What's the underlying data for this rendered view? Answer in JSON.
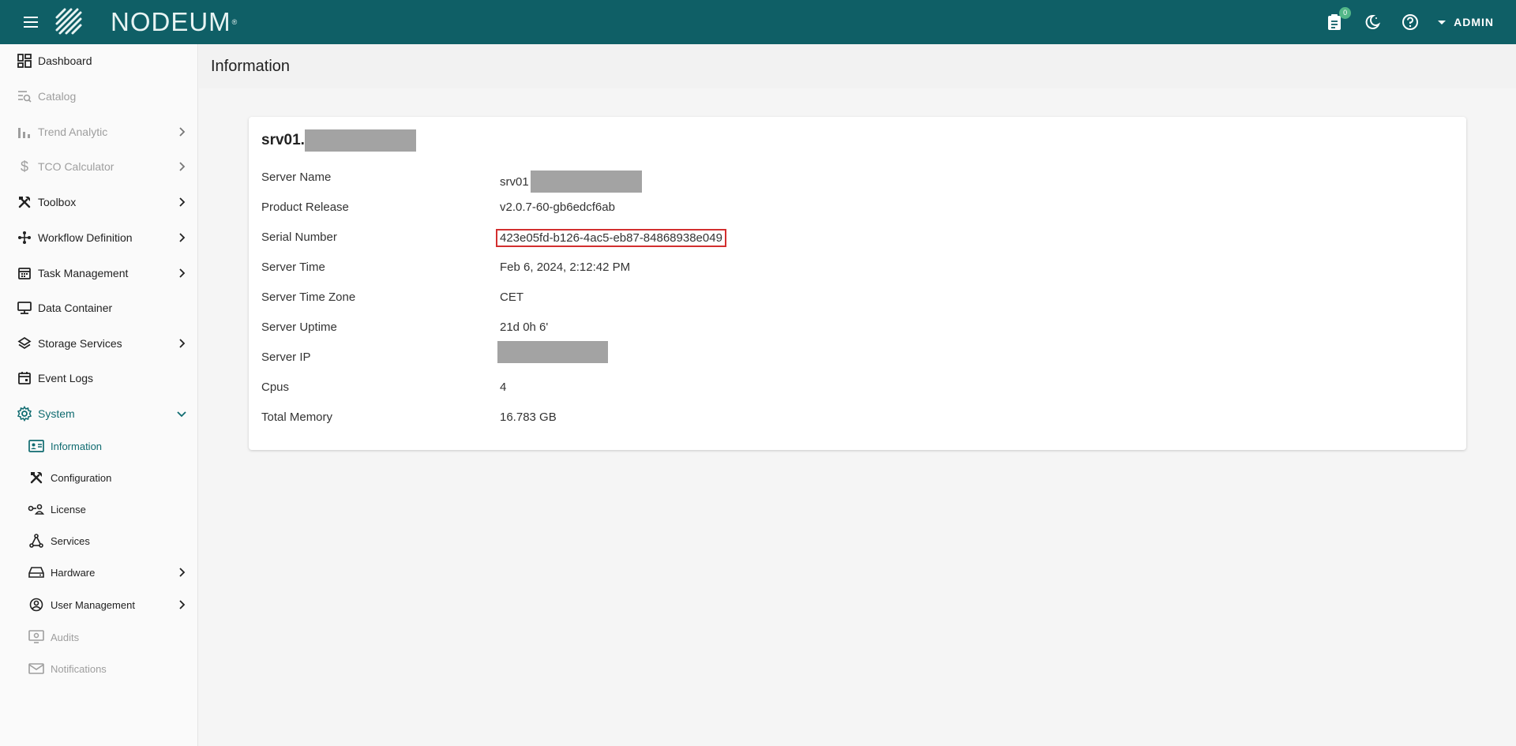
{
  "app": {
    "logo_text": "NODEUM",
    "logo_reg": "®",
    "notification_count": "0",
    "user": "ADMIN"
  },
  "sidebar": {
    "items": [
      {
        "label": "Dashboard",
        "icon": "dashboard-icon",
        "state": "normal"
      },
      {
        "label": "Catalog",
        "icon": "catalog-search-icon",
        "state": "disabled"
      },
      {
        "label": "Trend Analytic",
        "icon": "bar-chart-icon",
        "state": "disabled"
      },
      {
        "label": "TCO Calculator",
        "icon": "dollar-icon",
        "state": "disabled"
      },
      {
        "label": "Toolbox",
        "icon": "tools-icon",
        "state": "normal"
      },
      {
        "label": "Workflow Definition",
        "icon": "workflow-icon",
        "state": "normal"
      },
      {
        "label": "Task Management",
        "icon": "calendar-icon",
        "state": "normal"
      },
      {
        "label": "Data Container",
        "icon": "monitor-icon",
        "state": "normal"
      },
      {
        "label": "Storage Services",
        "icon": "layers-icon",
        "state": "normal"
      },
      {
        "label": "Event Logs",
        "icon": "event-calendar-icon",
        "state": "normal"
      },
      {
        "label": "System",
        "icon": "gear-icon",
        "state": "active"
      }
    ],
    "system_sub": [
      {
        "label": "Information",
        "icon": "id-card-icon",
        "state": "active"
      },
      {
        "label": "Configuration",
        "icon": "tools-icon",
        "state": "normal"
      },
      {
        "label": "License",
        "icon": "key-user-icon",
        "state": "normal"
      },
      {
        "label": "Services",
        "icon": "network-icon",
        "state": "normal"
      },
      {
        "label": "Hardware",
        "icon": "hard-drive-icon",
        "state": "normal"
      },
      {
        "label": "User Management",
        "icon": "user-circle-icon",
        "state": "normal"
      },
      {
        "label": "Audits",
        "icon": "audit-monitor-icon",
        "state": "disabled"
      },
      {
        "label": "Notifications",
        "icon": "mail-icon",
        "state": "disabled"
      }
    ]
  },
  "page": {
    "title": "Information"
  },
  "card": {
    "title_prefix": "srv01.",
    "rows": [
      {
        "key": "Server Name",
        "value": "srv01",
        "redacted": true
      },
      {
        "key": "Product Release",
        "value": "v2.0.7-60-gb6edcf6ab"
      },
      {
        "key": "Serial Number",
        "value": "423e05fd-b126-4ac5-eb87-84868938e049",
        "highlighted": true
      },
      {
        "key": "Server Time",
        "value": "Feb 6, 2024, 2:12:42 PM"
      },
      {
        "key": "Server Time Zone",
        "value": "CET"
      },
      {
        "key": "Server Uptime",
        "value": "21d 0h 6'"
      },
      {
        "key": "Server IP",
        "value": "",
        "redacted": true
      },
      {
        "key": "Cpus",
        "value": "4"
      },
      {
        "key": "Total Memory",
        "value": "16.783 GB"
      }
    ]
  },
  "colors": {
    "topbar": "#0f5f66",
    "active": "#0f6b70",
    "badge": "#52b788",
    "highlight": "#d32f2f",
    "redact": "#a3a3a3"
  }
}
